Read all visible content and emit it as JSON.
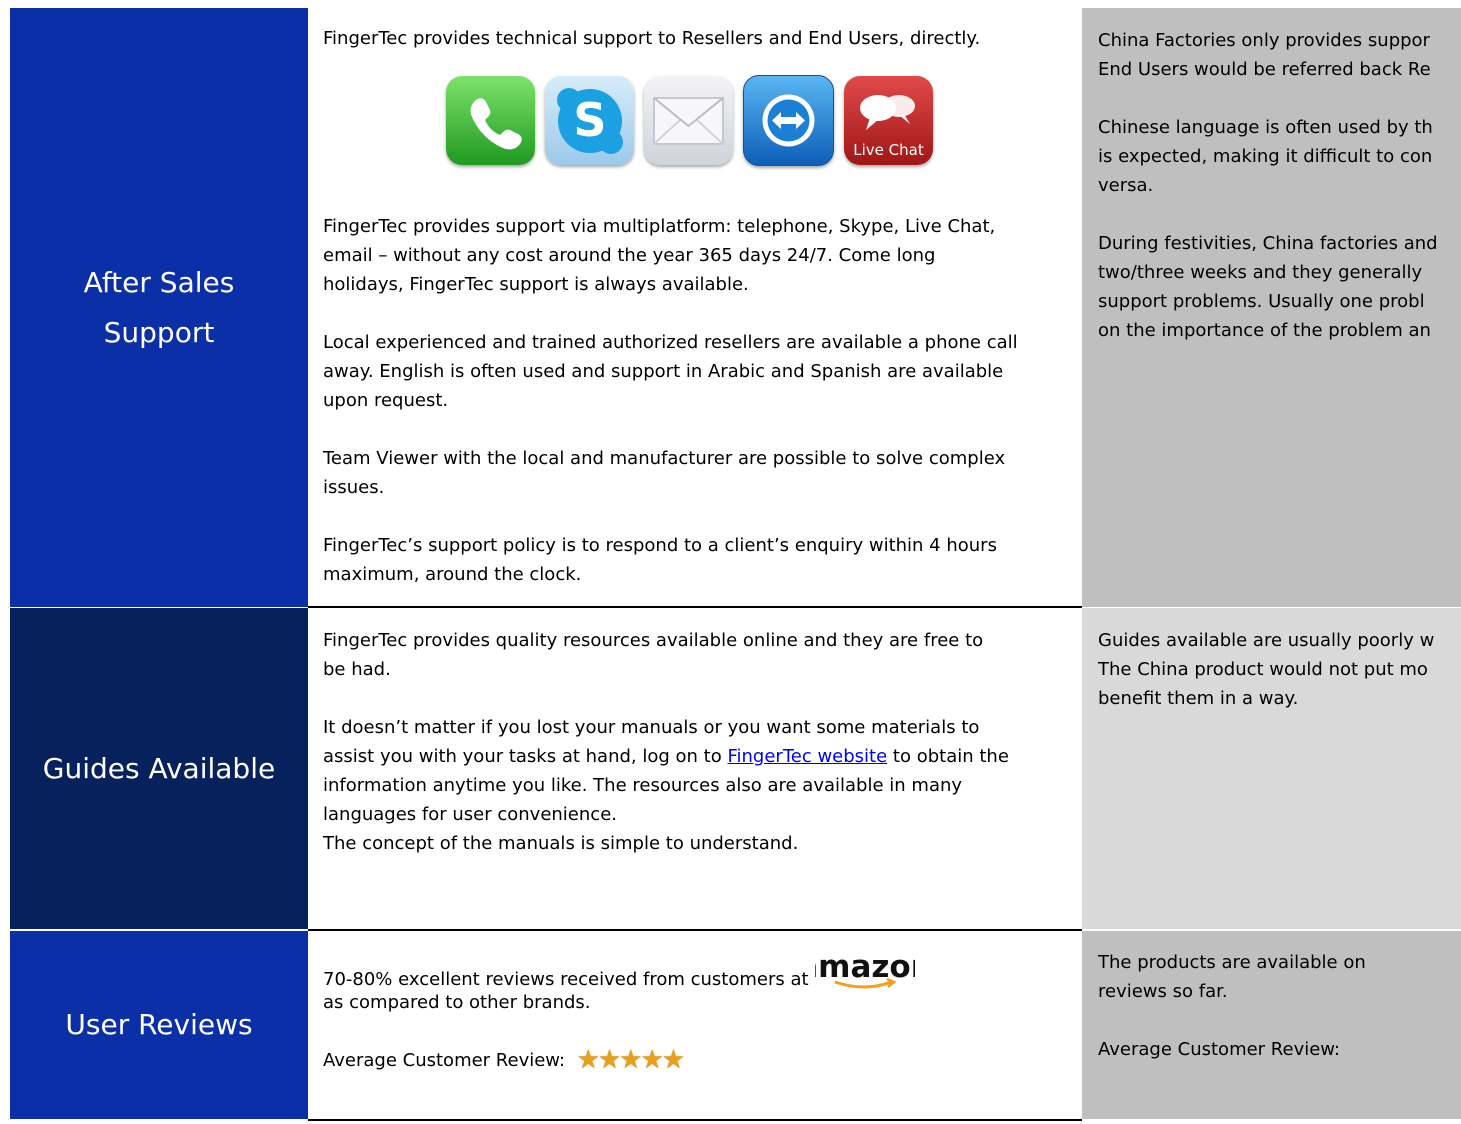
{
  "colors": {
    "label_blue": "#0a2fa6",
    "label_dark_blue": "#07215c",
    "right_gray": "#bfbfbf",
    "right_light_gray": "#d9d9d9",
    "star": "#e8a01a"
  },
  "rows": {
    "after_sales": {
      "label_line1": "After Sales",
      "label_line2": "Support",
      "mid": {
        "p1": "FingerTec provides technical support to Resellers and End Users, directly.",
        "icons": [
          "phone-icon",
          "skype-icon",
          "email-icon",
          "teamviewer-icon",
          "live-chat-icon"
        ],
        "live_chat_text": "Live Chat",
        "p2_l1": "FingerTec  provides support via multiplatform: telephone, Skype, Live Chat,",
        "p2_l2": "email – without any cost around the year 365 days 24/7. Come long",
        "p2_l3": "holidays, FingerTec support is always available.",
        "p3_l1": "Local experienced and trained authorized resellers are available a phone call",
        "p3_l2": "away. English is often used and support in Arabic and Spanish are available",
        "p3_l3": "upon request.",
        "p4_l1": "Team Viewer with the local and manufacturer are possible to solve complex",
        "p4_l2": "issues.",
        "p5_l1": "FingerTec’s support policy is to respond to a client’s enquiry within 4 hours",
        "p5_l2": "maximum, around the clock."
      },
      "right": {
        "p1_l1": "China Factories only provides suppor",
        "p1_l2": "End Users would be referred back Re",
        "p2_l1": "Chinese language is often used by th",
        "p2_l2": "is expected, making it difficult to con",
        "p2_l3": "versa.",
        "p3_l1": "During festivities, China factories and",
        "p3_l2": "two/three weeks and they generally",
        "p3_l3": "support problems. Usually one probl",
        "p3_l4": "on the importance of the problem an"
      }
    },
    "guides": {
      "label": "Guides Available",
      "mid": {
        "p1_l1": "FingerTec  provides quality resources available online and they are free to",
        "p1_l2": "be had.",
        "p2_l1": "It doesn’t matter if you lost your manuals or you want some materials to",
        "p2_l2_pre": "assist you with your tasks at hand, log on to",
        "p2_link": "FingerTec website",
        "p2_l2_post": "to obtain the",
        "p2_l3": "information anytime you like. The resources also are available in many",
        "p2_l4": "languages for user convenience.",
        "p3": "The concept of the manuals is simple to understand."
      },
      "right": {
        "l1": "Guides available are usually poorly w",
        "l2": "The China product would not put mo",
        "l3": "benefit them in a way."
      }
    },
    "reviews": {
      "label": "User Reviews",
      "mid": {
        "l1": "70-80% excellent reviews received from customers at",
        "amazon_logo": "amazon",
        "l2": "as compared to other brands.",
        "avg_label": "Average Customer Review:",
        "rating": 5,
        "stars": "★★★★★"
      },
      "right": {
        "l1": "The products are available on",
        "l2": "reviews so far.",
        "avg_label": "Average Customer Review:"
      }
    }
  }
}
